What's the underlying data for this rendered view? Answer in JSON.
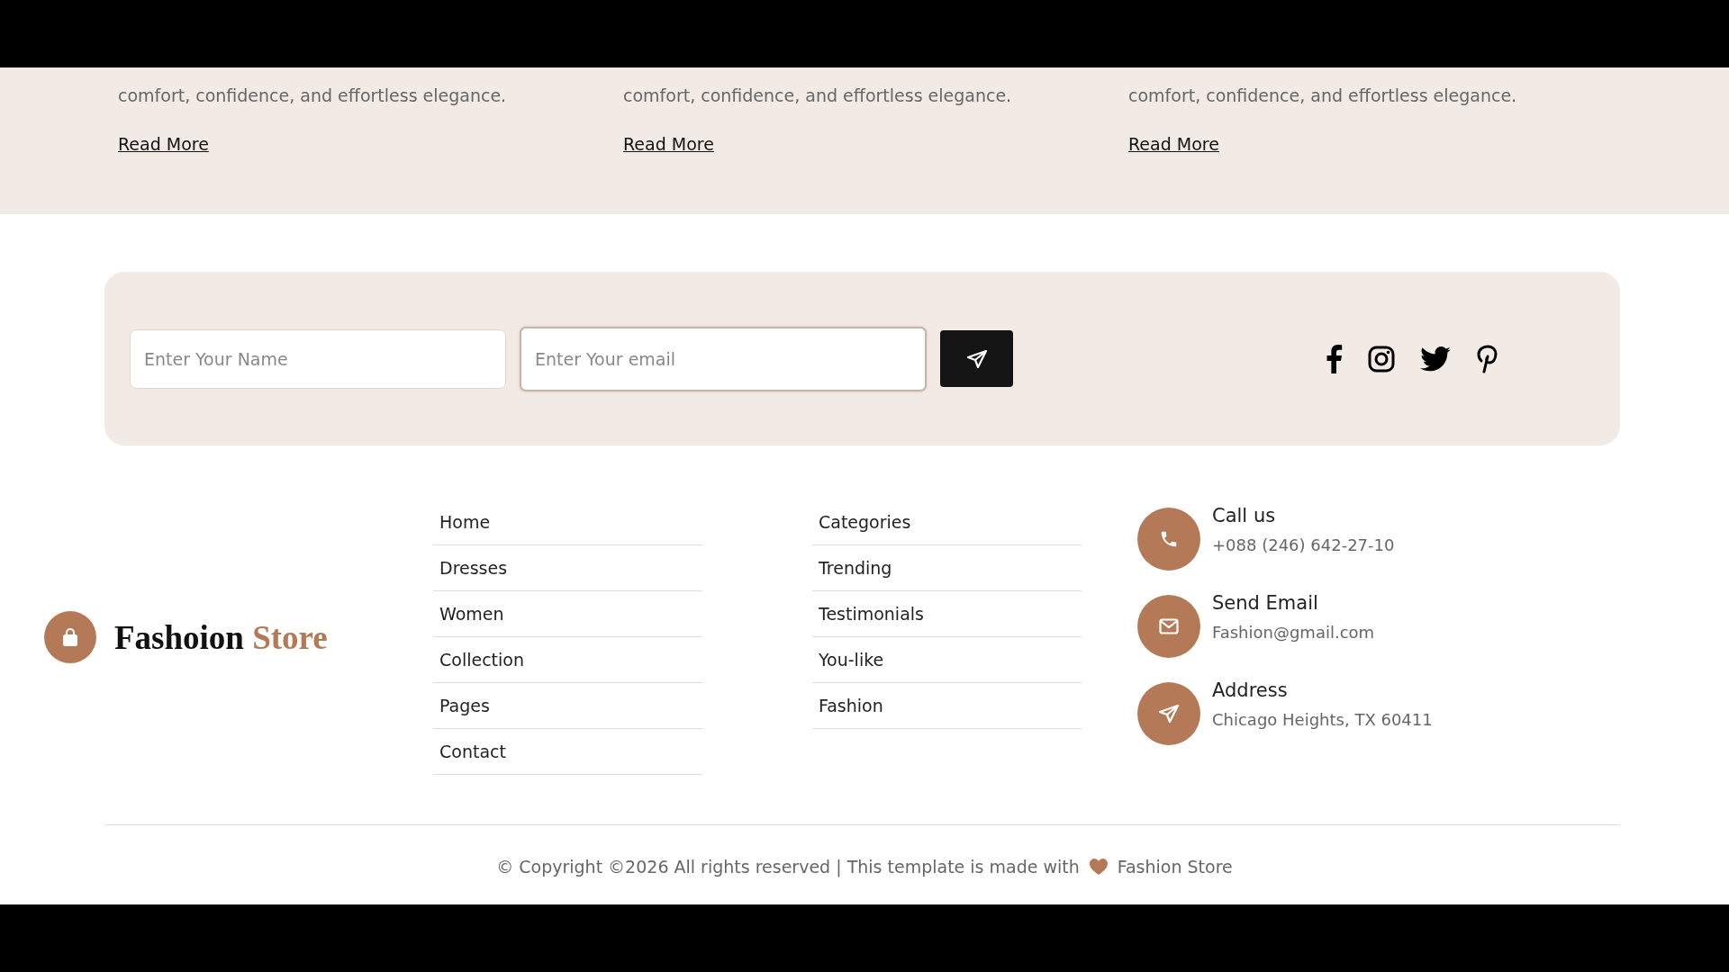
{
  "posts": [
    {
      "excerpt": "comfort, confidence, and effortless elegance.",
      "link": "Read More"
    },
    {
      "excerpt": "comfort, confidence, and effortless elegance.",
      "link": "Read More"
    },
    {
      "excerpt": "comfort, confidence, and effortless elegance.",
      "link": "Read More"
    }
  ],
  "subscribe": {
    "name_placeholder": "Enter Your Name",
    "email_placeholder": "Enter Your email",
    "email_focused": true
  },
  "social": [
    {
      "kind": "facebook"
    },
    {
      "kind": "instagram"
    },
    {
      "kind": "twitter"
    },
    {
      "kind": "pinterest"
    }
  ],
  "brand": {
    "name": "Fashoion",
    "accent": "Store"
  },
  "menus": [
    [
      "Home",
      "Dresses",
      "Women",
      "Collection",
      "Pages",
      "Contact"
    ],
    [
      "Categories",
      "Trending",
      "Testimonials",
      "You-like",
      "Fashion"
    ]
  ],
  "contacts": [
    {
      "kind": "phone",
      "title": "Call us",
      "value": "+088 (246) 642-27-10"
    },
    {
      "kind": "email",
      "title": "Send Email",
      "value": "Fashion@gmail.com"
    },
    {
      "kind": "address",
      "title": "Address",
      "value": "Chicago Heights, TX 60411"
    }
  ],
  "copyright": {
    "text": "© Copyright ©2026 All rights reserved | This template is made with",
    "brand": "Fashion Store"
  }
}
